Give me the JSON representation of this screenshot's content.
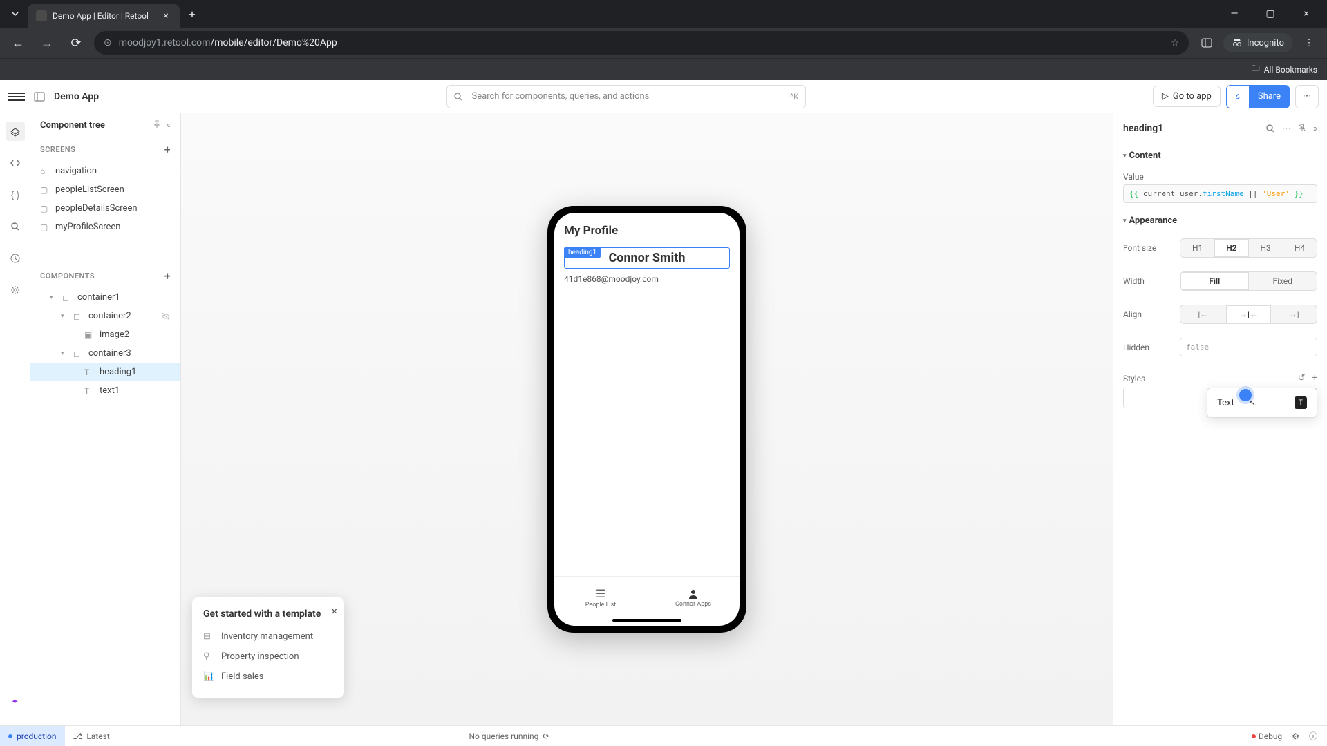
{
  "browser": {
    "tab_title": "Demo App | Editor | Retool",
    "url_host": "moodjoy1.retool.com",
    "url_path": "/mobile/editor/Demo%20App",
    "incognito_label": "Incognito",
    "all_bookmarks": "All Bookmarks"
  },
  "header": {
    "app_name": "Demo App",
    "search_placeholder": "Search for components, queries, and actions",
    "search_shortcut": "^K",
    "go_to_app": "Go to app",
    "share": "Share"
  },
  "left_panel": {
    "title": "Component tree",
    "screens_label": "SCREENS",
    "components_label": "COMPONENTS",
    "screens": [
      {
        "name": "navigation",
        "icon": "home"
      },
      {
        "name": "peopleListScreen",
        "icon": "screen"
      },
      {
        "name": "peopleDetailsScreen",
        "icon": "screen"
      },
      {
        "name": "myProfileScreen",
        "icon": "screen"
      }
    ],
    "components": [
      {
        "name": "container1",
        "depth": 1,
        "caret": true,
        "icon": "box"
      },
      {
        "name": "container2",
        "depth": 2,
        "caret": true,
        "icon": "box",
        "hidden": true
      },
      {
        "name": "image2",
        "depth": 3,
        "icon": "image"
      },
      {
        "name": "container3",
        "depth": 2,
        "caret": true,
        "icon": "box"
      },
      {
        "name": "heading1",
        "depth": 3,
        "icon": "text",
        "selected": true
      },
      {
        "name": "text1",
        "depth": 3,
        "icon": "text"
      }
    ]
  },
  "phone": {
    "screen_title": "My Profile",
    "heading_badge": "heading1",
    "heading_text": "Connor Smith",
    "email": "41d1e868@moodjoy.com",
    "tabs": [
      {
        "label": "People List",
        "icon": "list"
      },
      {
        "label": "Connor Apps",
        "icon": "person"
      }
    ]
  },
  "template_toast": {
    "title": "Get started with a template",
    "items": [
      "Inventory management",
      "Property inspection",
      "Field sales"
    ]
  },
  "inspector": {
    "title": "heading1",
    "content_label": "Content",
    "value_label": "Value",
    "value_expr_parts": {
      "open": "{{ ",
      "obj": "current_user",
      "dot": ".",
      "prop": "firstName",
      "or": " || ",
      "str": "'User'",
      "close": " }}"
    },
    "appearance_label": "Appearance",
    "font_size_label": "Font size",
    "font_sizes": [
      "H1",
      "H2",
      "H3",
      "H4"
    ],
    "font_size_active": "H2",
    "width_label": "Width",
    "width_options": [
      "Fill",
      "Fixed"
    ],
    "width_active": "Fill",
    "align_label": "Align",
    "hidden_label": "Hidden",
    "hidden_value": "false",
    "styles_label": "Styles",
    "style_option": "Text"
  },
  "footer": {
    "env": "production",
    "latest": "Latest",
    "queries_status": "No queries running",
    "debug": "Debug"
  }
}
